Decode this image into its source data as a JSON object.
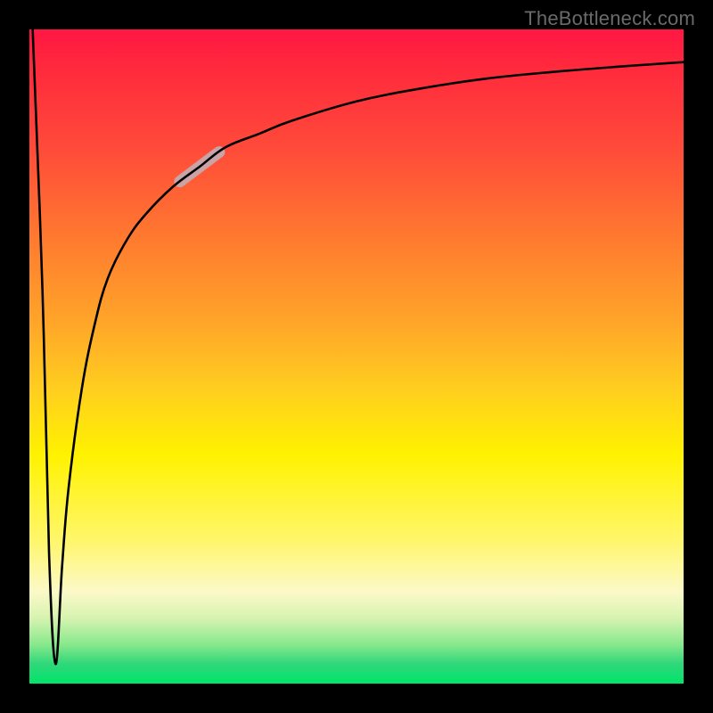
{
  "watermark": "TheBottleneck.com",
  "chart_data": {
    "type": "line",
    "title": "",
    "xlabel": "",
    "ylabel": "",
    "xlim": [
      0,
      100
    ],
    "ylim": [
      0,
      100
    ],
    "grid": false,
    "legend": false,
    "annotation": {
      "kind": "highlight-segment",
      "x_range": [
        23,
        29
      ],
      "color": "#caa3a6"
    },
    "gradient_stops": [
      {
        "pos": 0.0,
        "color": "#ff1744"
      },
      {
        "pos": 0.06,
        "color": "#ff2a3c"
      },
      {
        "pos": 0.18,
        "color": "#ff4a3a"
      },
      {
        "pos": 0.32,
        "color": "#ff7a2f"
      },
      {
        "pos": 0.45,
        "color": "#ffa629"
      },
      {
        "pos": 0.55,
        "color": "#ffce1f"
      },
      {
        "pos": 0.65,
        "color": "#fff200"
      },
      {
        "pos": 0.78,
        "color": "#fff66a"
      },
      {
        "pos": 0.86,
        "color": "#fcf9c8"
      },
      {
        "pos": 0.9,
        "color": "#d6f3b0"
      },
      {
        "pos": 0.94,
        "color": "#88e98c"
      },
      {
        "pos": 0.97,
        "color": "#2fd77a"
      },
      {
        "pos": 1.0,
        "color": "#00e56a"
      }
    ],
    "series": [
      {
        "name": "bottleneck-curve",
        "x": [
          0.5,
          2.0,
          3.0,
          4.0,
          5.0,
          6.0,
          8.0,
          10,
          12,
          15,
          18,
          22,
          26,
          30,
          35,
          40,
          50,
          60,
          70,
          80,
          90,
          100
        ],
        "y": [
          100,
          60,
          20,
          3,
          18,
          30,
          45,
          55,
          62,
          68,
          72,
          76,
          79,
          82,
          84,
          86,
          89,
          91,
          92.5,
          93.5,
          94.3,
          95
        ]
      }
    ]
  }
}
